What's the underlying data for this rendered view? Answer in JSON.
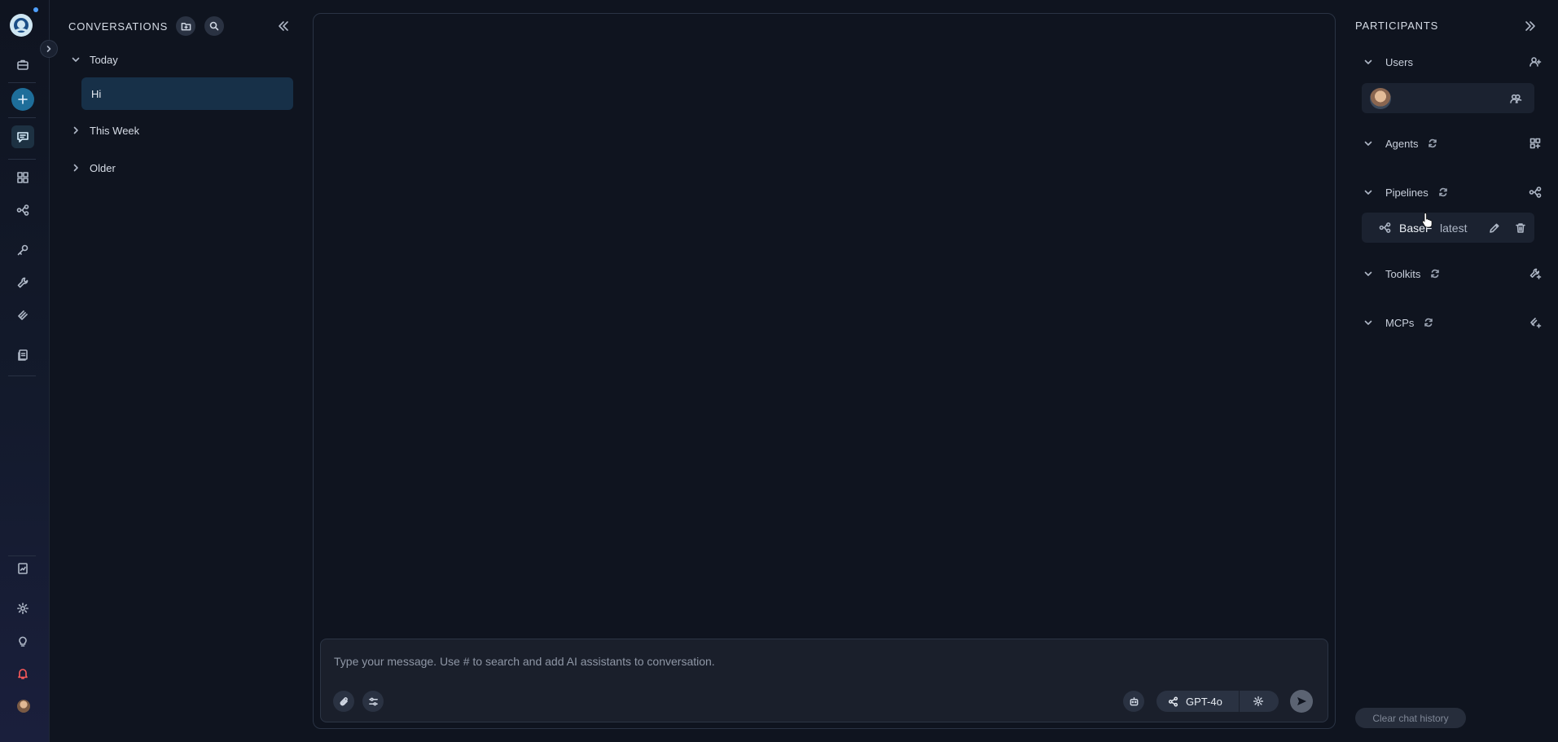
{
  "conversations": {
    "title": "CONVERSATIONS",
    "groups": [
      {
        "label": "Today",
        "expanded": true,
        "items": [
          {
            "label": "Hi",
            "selected": true
          }
        ]
      },
      {
        "label": "This Week",
        "expanded": false,
        "items": []
      },
      {
        "label": "Older",
        "expanded": false,
        "items": []
      }
    ]
  },
  "composer": {
    "placeholder": "Type your message. Use # to search and add AI assistants to conversation.",
    "model": "GPT-4o"
  },
  "participants": {
    "title": "PARTICIPANTS",
    "sections": {
      "users": "Users",
      "agents": "Agents",
      "pipelines": "Pipelines",
      "toolkits": "Toolkits",
      "mcps": "MCPs"
    },
    "pipeline_item": {
      "name": "BaseF",
      "version": "latest"
    },
    "clear_label": "Clear chat history"
  },
  "colors": {
    "background": "#0f141f",
    "accent": "#1e6e9a",
    "selected_item": "#173048",
    "panel_card": "#1b2230"
  },
  "icons": [
    "logo",
    "expand-chevron-icon",
    "briefcase-icon",
    "plus-icon",
    "chat-icon",
    "grid-icon",
    "pipeline-icon",
    "key-icon",
    "wrench-icon",
    "mcp-icon",
    "documents-icon",
    "reports-icon",
    "settings-icon",
    "lightbulb-icon",
    "bell-icon"
  ]
}
